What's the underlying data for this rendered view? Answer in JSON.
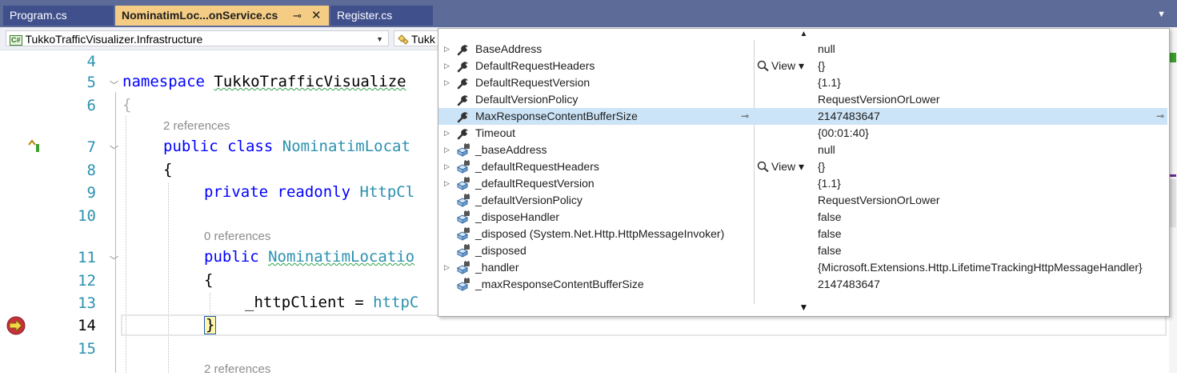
{
  "tabs": [
    {
      "label": "Program.cs",
      "active": false
    },
    {
      "label": "NominatimLoc...onService.cs",
      "active": true,
      "pin": "⊸",
      "close": "✕"
    },
    {
      "label": "Register.cs",
      "active": false
    }
  ],
  "tab_overflow_icon": "chevron-down-icon",
  "navbar": {
    "project_badge": "C#",
    "project": "TukkoTrafficVisualizer.Infrastructure",
    "type_combo": "Tukk"
  },
  "editor": {
    "line_numbers": [
      "4",
      "5",
      "6",
      "7",
      "8",
      "9",
      "10",
      "11",
      "12",
      "13",
      "14",
      "15"
    ],
    "code": {
      "l5_kw": "namespace",
      "l5_name": "TukkoTrafficVisualize",
      "l6": "{",
      "refs_class": "2 references",
      "l7_kw1": "public",
      "l7_kw2": "class",
      "l7_type": "NominatimLocat",
      "l8": "{",
      "l9_kw1": "private",
      "l9_kw2": "readonly",
      "l9_type": "HttpCl",
      "refs_ctor": "0 references",
      "l11_kw": "public",
      "l11_type": "NominatimLocatio",
      "l12": "{",
      "l13_a": "_httpClient = ",
      "l13_b": "httpC",
      "l14": "}",
      "refs_bottom": "2 references"
    }
  },
  "datatip": {
    "scroll_up": "▲",
    "scroll_down": "▼",
    "view_label": "View",
    "rows": [
      {
        "name": "BaseAddress",
        "value": "null",
        "expandable": true,
        "icon": "wrench-icon"
      },
      {
        "name": "DefaultRequestHeaders",
        "value": "{}",
        "expandable": true,
        "icon": "wrench-icon",
        "view": true
      },
      {
        "name": "DefaultRequestVersion",
        "value": "{1.1}",
        "expandable": true,
        "icon": "wrench-icon"
      },
      {
        "name": "DefaultVersionPolicy",
        "value": "RequestVersionOrLower",
        "expandable": false,
        "icon": "wrench-icon"
      },
      {
        "name": "MaxResponseContentBufferSize",
        "value": "2147483647",
        "expandable": false,
        "icon": "wrench-icon",
        "selected": true
      },
      {
        "name": "Timeout",
        "value": "{00:01:40}",
        "expandable": true,
        "icon": "wrench-icon"
      },
      {
        "name": "_baseAddress",
        "value": "null",
        "expandable": true,
        "icon": "private-field-icon"
      },
      {
        "name": "_defaultRequestHeaders",
        "value": "{}",
        "expandable": true,
        "icon": "private-field-icon",
        "view": true
      },
      {
        "name": "_defaultRequestVersion",
        "value": "{1.1}",
        "expandable": true,
        "icon": "private-field-icon"
      },
      {
        "name": "_defaultVersionPolicy",
        "value": "RequestVersionOrLower",
        "expandable": false,
        "icon": "private-field-icon"
      },
      {
        "name": "_disposeHandler",
        "value": "false",
        "expandable": false,
        "icon": "private-field-icon"
      },
      {
        "name": "_disposed (System.Net.Http.HttpMessageInvoker)",
        "value": "false",
        "expandable": false,
        "icon": "private-field-icon"
      },
      {
        "name": "_disposed",
        "value": "false",
        "expandable": false,
        "icon": "private-field-icon"
      },
      {
        "name": "_handler",
        "value": "{Microsoft.Extensions.Http.LifetimeTrackingHttpMessageHandler}",
        "expandable": true,
        "icon": "private-field-icon"
      },
      {
        "name": "_maxResponseContentBufferSize",
        "value": "2147483647",
        "expandable": false,
        "icon": "private-field-icon"
      }
    ]
  },
  "colors": {
    "tab_strip": "#5d6b99",
    "active_tab": "#f5cc84",
    "selected_row": "#cce4f7",
    "keyword": "#0000ff",
    "type": "#2b91af"
  }
}
